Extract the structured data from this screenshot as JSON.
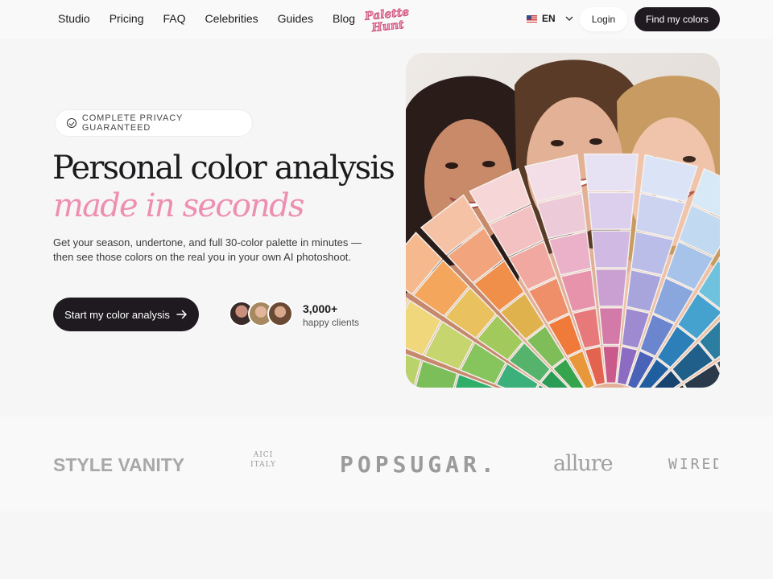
{
  "nav": {
    "links": [
      "Studio",
      "Pricing",
      "FAQ",
      "Celebrities",
      "Guides",
      "Blog"
    ],
    "logo_text": [
      "Palette",
      "Hunt"
    ],
    "language": "EN",
    "login_label": "Login",
    "cta_label": "Find my colors"
  },
  "hero": {
    "badge": "COMPLETE PRIVACY GUARANTEED",
    "title_line1": "Personal color analysis",
    "title_line2": "made in seconds",
    "subtitle": "Get your season, undertone, and full 30-color palette in minutes — then see those colors on the real you in your own AI photoshoot.",
    "cta_label": "Start my color analysis",
    "clients_count": "3,000+",
    "clients_label": "happy clients"
  },
  "press": {
    "logos": [
      "STYLE VANITY",
      "AICI ITALY",
      "POPSUGAR.",
      "allure",
      "WIRED"
    ]
  },
  "colors": {
    "accent_pink": "#ee8fb1",
    "dark": "#1e1a1f",
    "background": "#f6f6f6"
  }
}
